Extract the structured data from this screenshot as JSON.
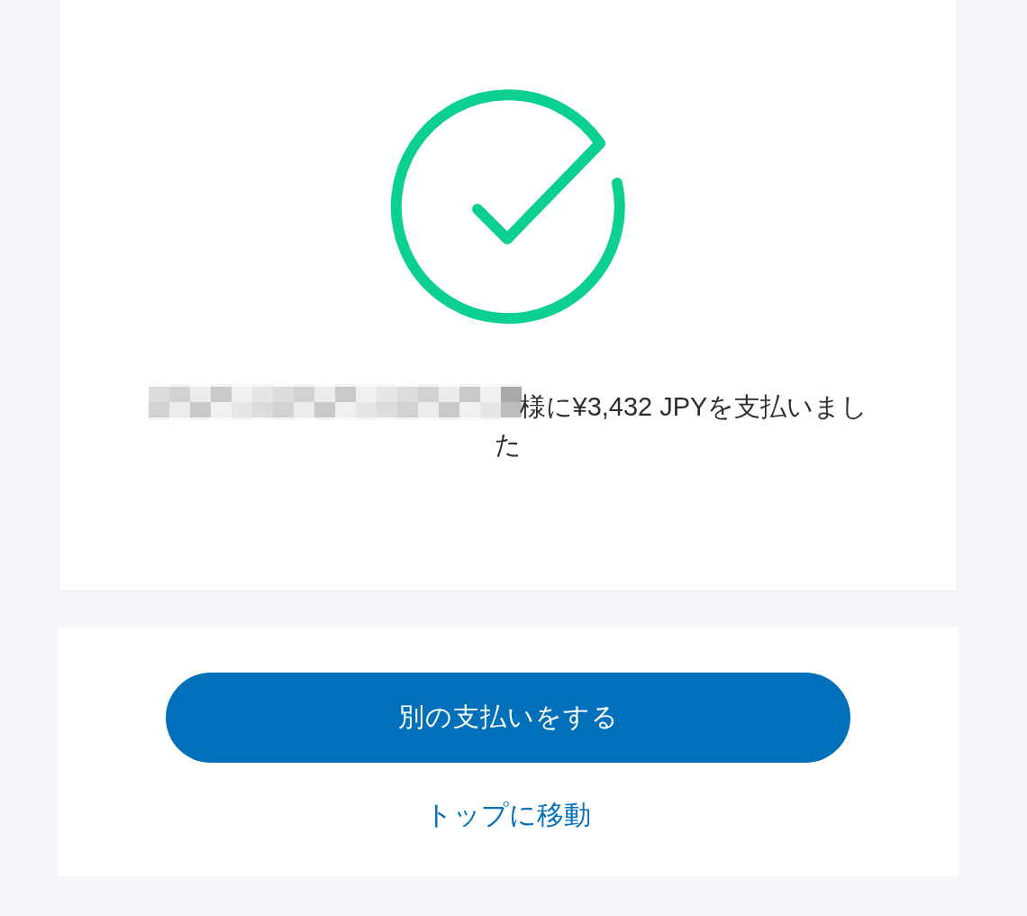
{
  "success_card": {
    "message": "様に¥3,432 JPYを支払いました"
  },
  "actions": {
    "primary_button": "別の支払いをする",
    "link": "トップに移動"
  }
}
